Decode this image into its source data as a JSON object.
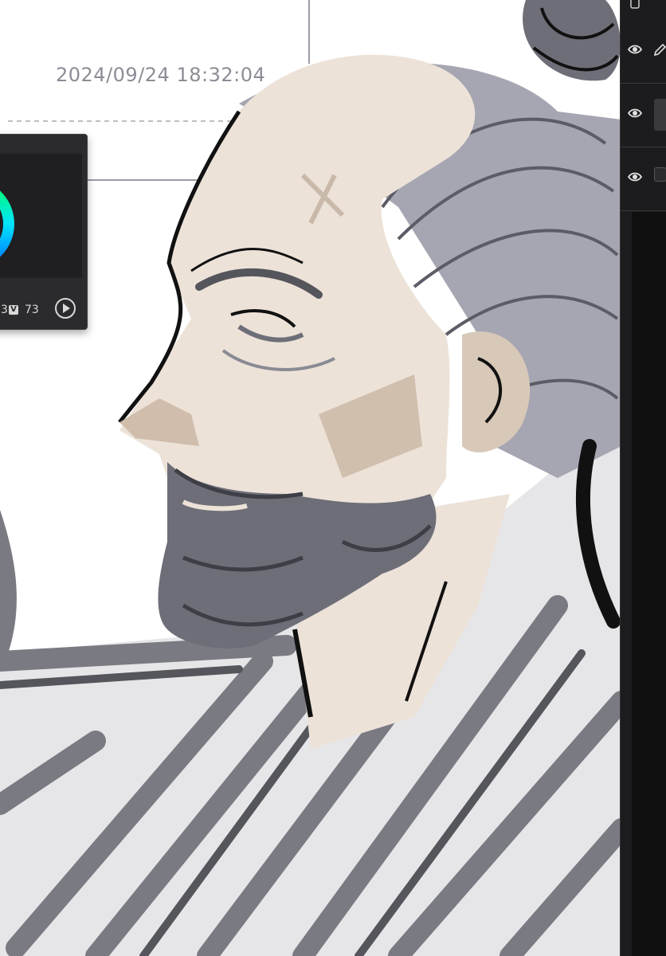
{
  "canvas": {
    "timestamp": "2024/09/24 18:32:04"
  },
  "color_picker": {
    "prev_value": "3",
    "v_label": "V",
    "v_value": "73",
    "play_icon": "play-circle-icon"
  },
  "layers": {
    "items": [
      {
        "visibility_icon": "eye-icon",
        "tool_icon": "pencil-icon"
      },
      {
        "visibility_icon": "eye-icon"
      },
      {
        "visibility_icon": "eye-icon"
      }
    ]
  },
  "colors": {
    "skin": "#e9ddd2",
    "hair": "#a6a6b2",
    "beard": "#6e6e78",
    "line": "#111111",
    "robe": "#7a7a82",
    "panel": "#2b2b2d",
    "sidebar": "#1c1c1e"
  }
}
